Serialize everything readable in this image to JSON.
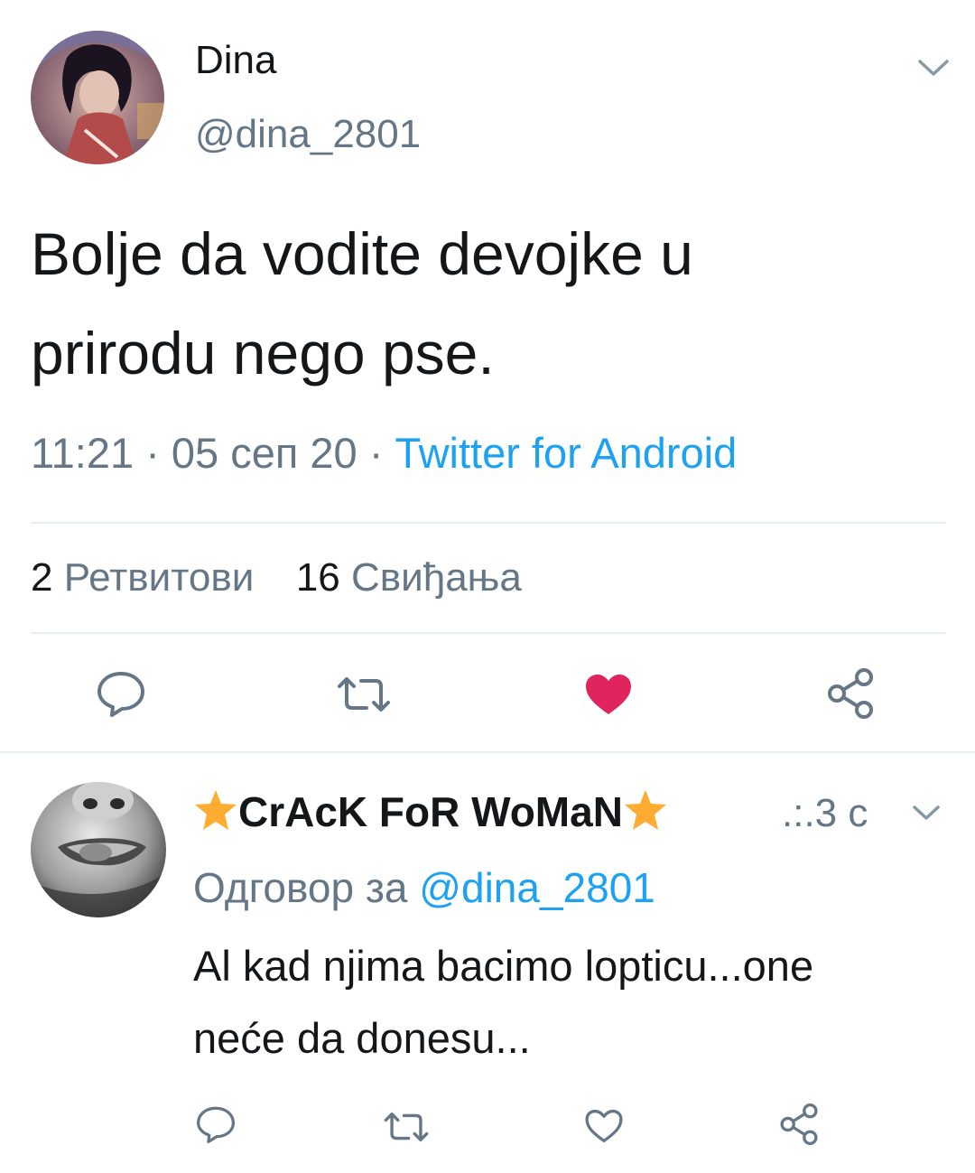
{
  "tweet": {
    "author": {
      "name": "Dina",
      "handle": "@dina_2801",
      "avatar_icon": "profile-photo-woman"
    },
    "text_line1": "Bolje da vodite devojke u",
    "text_line2": "prirodu nego pse.",
    "time": "11:21",
    "date": "05 сеп 20",
    "separator": "·",
    "source": "Twitter for Android",
    "stats": {
      "retweets_count": "2",
      "retweets_label": "Ретвитови",
      "likes_count": "16",
      "likes_label": "Свиђања"
    },
    "liked": true
  },
  "reply": {
    "author": {
      "name": "CrAcK FoR WoMaN",
      "name_decoration_icon": "star-emoji",
      "avatar_icon": "profile-photo-face-bw"
    },
    "time": ".:.3 с",
    "replying_prefix": "Одговор за",
    "replying_to": "@dina_2801",
    "text_line1": "Al kad njima bacimo lopticu...one",
    "text_line2": "neće da donesu...",
    "liked": false
  },
  "colors": {
    "text": "#14171a",
    "secondary": "#657786",
    "link": "#1da1f2",
    "like": "#e0245e",
    "divider": "#e6ecf0",
    "star": "#ffac33"
  }
}
